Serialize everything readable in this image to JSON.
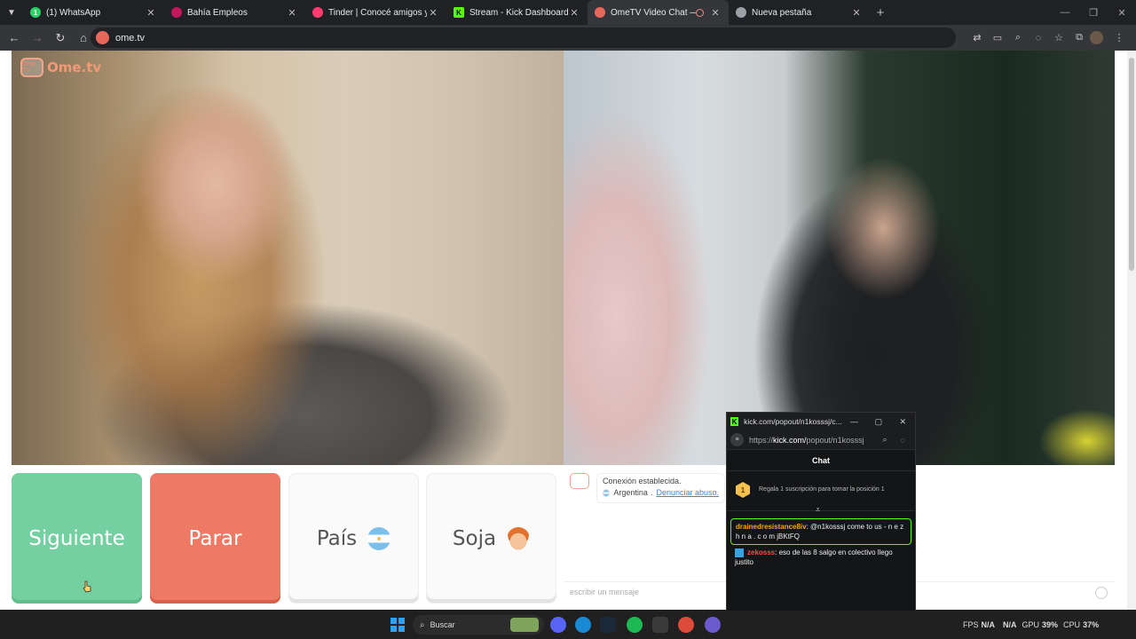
{
  "tabs": [
    {
      "title": "(1) WhatsApp",
      "favicon_color": "#25d366",
      "favicon_text": "1"
    },
    {
      "title": "Bahía Empleos",
      "favicon_color": "#c2185b",
      "favicon_text": ""
    },
    {
      "title": "Tinder | Conocé amigos y gente",
      "favicon_color": "#fe3c72",
      "favicon_text": ""
    },
    {
      "title": "Stream - Kick Dashboard",
      "favicon_color": "#53fc18",
      "favicon_text": "K"
    },
    {
      "title": "OmeTV Video Chat — Alter",
      "favicon_color": "#e7685b",
      "favicon_text": "",
      "active": true
    },
    {
      "title": "Nueva pestaña",
      "favicon_color": "#9aa0a6",
      "favicon_text": ""
    }
  ],
  "address": {
    "url": "ome.tv"
  },
  "ome": {
    "logo_badge": "Ome TV",
    "logo_text": "Ome.tv",
    "buttons": {
      "next": "Siguiente",
      "stop": "Parar",
      "country": "País",
      "gender": "Soja"
    },
    "chat": {
      "status": "Conexión establecida.",
      "country": "Argentina",
      "report": "Denunciar abuso.",
      "placeholder": "escribir un mensaje"
    }
  },
  "popout": {
    "title": "kick.com/popout/n1kosssj/c...",
    "url_prefix": "https://",
    "url_domain": "kick.com/",
    "url_path": "popout/n1kosssj",
    "header": "Chat",
    "gift_rank": "1",
    "gift_text": "Regala 1 suscripción para tomar la posición 1",
    "messages": [
      {
        "user": "drainedresistance8iv",
        "text": ": @n1kosssj come to us - n e z h n a . c o m jBKtFQ"
      },
      {
        "user": "zekosss",
        "text": ": eso de las 8 salgo en colectivo llego justito"
      }
    ]
  },
  "taskbar": {
    "search": "Buscar",
    "fps_label": "FPS",
    "fps_value": "N/A",
    "n_a": "N/A",
    "gpu_label": "GPU",
    "gpu_value": "39%",
    "cpu_label": "CPU",
    "cpu_value": "37%"
  }
}
